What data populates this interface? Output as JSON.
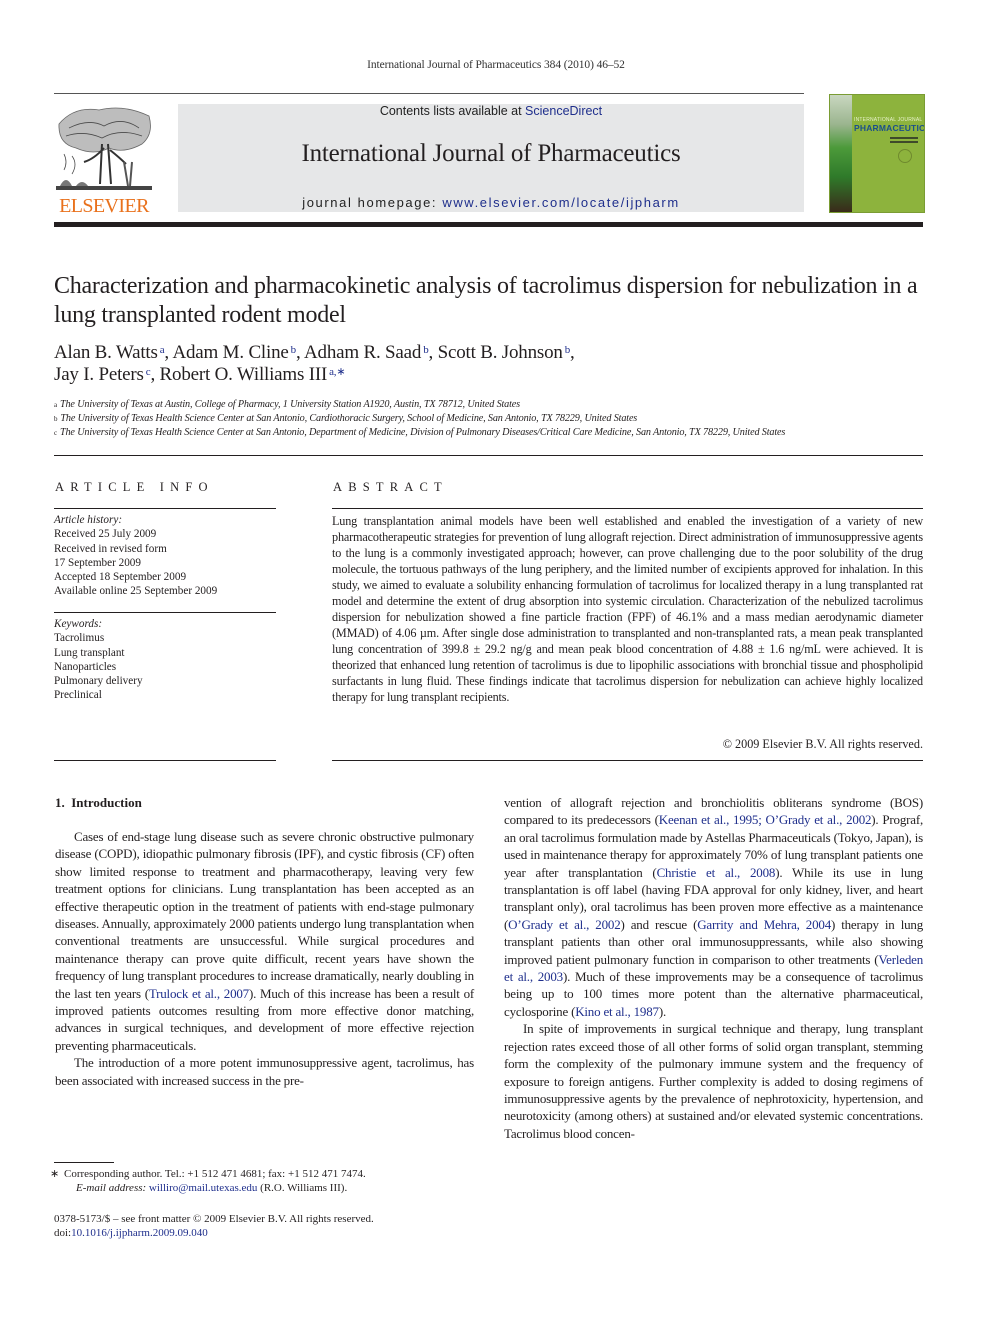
{
  "running_head": "International Journal of Pharmaceutics 384 (2010) 46–52",
  "masthead": {
    "publisher": "ELSEVIER",
    "contents_prefix": "Contents lists available at ",
    "contents_link": "ScienceDirect",
    "journal_title": "International Journal of Pharmaceutics",
    "homepage_prefix": "journal homepage: ",
    "homepage_link": "www.elsevier.com/locate/ijpharm",
    "cover_small": "INTERNATIONAL JOURNAL OF",
    "cover_big": "PHARMACEUTICS",
    "colors": {
      "publisher_orange": "#e9711c",
      "link_blue": "#1f2f8c",
      "box_gray": "#e6e7e8",
      "cover_green": "#8db33d"
    }
  },
  "article": {
    "title": "Characterization and pharmacokinetic analysis of tacrolimus dispersion for nebulization in a lung transplanted rodent model",
    "authors": [
      {
        "name": "Alan B. Watts",
        "sup": "a",
        "sep": ", "
      },
      {
        "name": "Adam M. Cline",
        "sup": "b",
        "sep": ", "
      },
      {
        "name": "Adham R. Saad",
        "sup": "b",
        "sep": ", "
      },
      {
        "name": "Scott B. Johnson",
        "sup": "b",
        "sep": ","
      },
      {
        "name": "Jay I. Peters",
        "sup": "c",
        "sep": ", "
      },
      {
        "name": "Robert O. Williams III",
        "sup": "a,∗",
        "sep": ""
      }
    ],
    "affiliations": [
      {
        "key": "a",
        "text": "The University of Texas at Austin, College of Pharmacy, 1 University Station A1920, Austin, TX 78712, United States"
      },
      {
        "key": "b",
        "text": "The University of Texas Health Science Center at San Antonio, Cardiothoracic Surgery, School of Medicine, San Antonio, TX 78229, United States"
      },
      {
        "key": "c",
        "text": "The University of Texas Health Science Center at San Antonio, Department of Medicine, Division of Pulmonary Diseases/Critical Care Medicine, San Antonio, TX 78229, United States"
      }
    ]
  },
  "article_info": {
    "heading": "ARTICLE INFO",
    "history_label": "Article history:",
    "history": [
      "Received 25 July 2009",
      "Received in revised form",
      "17 September 2009",
      "Accepted 18 September 2009",
      "Available online 25 September 2009"
    ],
    "keywords_label": "Keywords:",
    "keywords": [
      "Tacrolimus",
      "Lung transplant",
      "Nanoparticles",
      "Pulmonary delivery",
      "Preclinical"
    ]
  },
  "abstract": {
    "heading": "ABSTRACT",
    "text": "Lung transplantation animal models have been well established and enabled the investigation of a variety of new pharmacotherapeutic strategies for prevention of lung allograft rejection. Direct administration of immunosuppressive agents to the lung is a commonly investigated approach; however, can prove challenging due to the poor solubility of the drug molecule, the tortuous pathways of the lung periphery, and the limited number of excipients approved for inhalation. In this study, we aimed to evaluate a solubility enhancing formulation of tacrolimus for localized therapy in a lung transplanted rat model and determine the extent of drug absorption into systemic circulation. Characterization of the nebulized tacrolimus dispersion for nebulization showed a fine particle fraction (FPF) of 46.1% and a mass median aerodynamic diameter (MMAD) of 4.06 µm. After single dose administration to transplanted and non-transplanted rats, a mean peak transplanted lung concentration of 399.8 ± 29.2 ng/g and mean peak blood concentration of 4.88 ± 1.6 ng/mL were achieved. It is theorized that enhanced lung retention of tacrolimus is due to lipophilic associations with bronchial tissue and phospholipid surfactants in lung fluid. These findings indicate that tacrolimus dispersion for nebulization can achieve highly localized therapy for lung transplant recipients.",
    "copyright": "© 2009 Elsevier B.V. All rights reserved."
  },
  "introduction": {
    "heading": "1.  Introduction",
    "left_paragraphs": [
      [
        {
          "t": "Cases of end-stage lung disease such as severe chronic obstructive pulmonary disease (COPD), idiopathic pulmonary fibrosis (IPF), and cystic fibrosis (CF) often show limited response to treatment and pharmacotherapy, leaving very few treatment options for clinicians. Lung transplantation has been accepted as an effective therapeutic option in the treatment of patients with end-stage pulmonary diseases. Annually, approximately 2000 patients undergo lung transplantation when conventional treatments are unsuccessful. While surgical procedures and maintenance therapy can prove quite difficult, recent years have shown the frequency of lung transplant procedures to increase dramatically, nearly doubling in the last ten years ("
        },
        {
          "t": "Trulock et al., 2007",
          "link": true
        },
        {
          "t": "). Much of this increase has been a result of improved patients outcomes resulting from more effective donor matching, advances in surgical techniques, and development of more effective rejection preventing pharmaceuticals."
        }
      ],
      [
        {
          "t": "The introduction of a more potent immunosuppressive agent, tacrolimus, has been associated with increased success in the pre-"
        }
      ]
    ],
    "right_paragraphs": [
      [
        {
          "t": "vention of allograft rejection and bronchiolitis obliterans syndrome (BOS) compared to its predecessors ("
        },
        {
          "t": "Keenan et al., 1995; O’Grady et al., 2002",
          "link": true
        },
        {
          "t": "). Prograf, an oral tacrolimus formulation made by Astellas Pharmaceuticals (Tokyo, Japan), is used in maintenance therapy for approximately 70% of lung transplant patients one year after transplantation ("
        },
        {
          "t": "Christie et al., 2008",
          "link": true
        },
        {
          "t": "). While its use in lung transplantation is off label (having FDA approval for only kidney, liver, and heart transplant only), oral tacrolimus has been proven more effective as a maintenance ("
        },
        {
          "t": "O’Grady et al., 2002",
          "link": true
        },
        {
          "t": ") and rescue ("
        },
        {
          "t": "Garrity and Mehra, 2004",
          "link": true
        },
        {
          "t": ") therapy in lung transplant patients than other oral immunosuppressants, while also showing improved patient pulmonary function in comparison to other treatments ("
        },
        {
          "t": "Verleden et al., 2003",
          "link": true
        },
        {
          "t": "). Much of these improvements may be a consequence of tacrolimus being up to 100 times more potent than the alternative pharmaceutical, cyclosporine ("
        },
        {
          "t": "Kino et al., 1987",
          "link": true
        },
        {
          "t": ")."
        }
      ],
      [
        {
          "t": "In spite of improvements in surgical technique and therapy, lung transplant rejection rates exceed those of all other forms of solid organ transplant, stemming form the complexity of the pulmonary immune system and the frequency of exposure to foreign antigens. Further complexity is added to dosing regimens of immunosuppressive agents by the prevalence of nephrotoxicity, hypertension, and neurotoxicity (among others) at sustained and/or elevated systemic concentrations. Tacrolimus blood concen-"
        }
      ]
    ]
  },
  "footnote": {
    "marker": "∗",
    "corresponding": "Corresponding author. Tel.: +1 512 471 4681; fax: +1 512 471 7474.",
    "email_label": "E-mail address:",
    "email": "williro@mail.utexas.edu",
    "email_suffix": " (R.O. Williams III)."
  },
  "front_matter": {
    "issn_line": "0378-5173/$ – see front matter © 2009 Elsevier B.V. All rights reserved.",
    "doi_prefix": "doi:",
    "doi": "10.1016/j.ijpharm.2009.09.040"
  }
}
